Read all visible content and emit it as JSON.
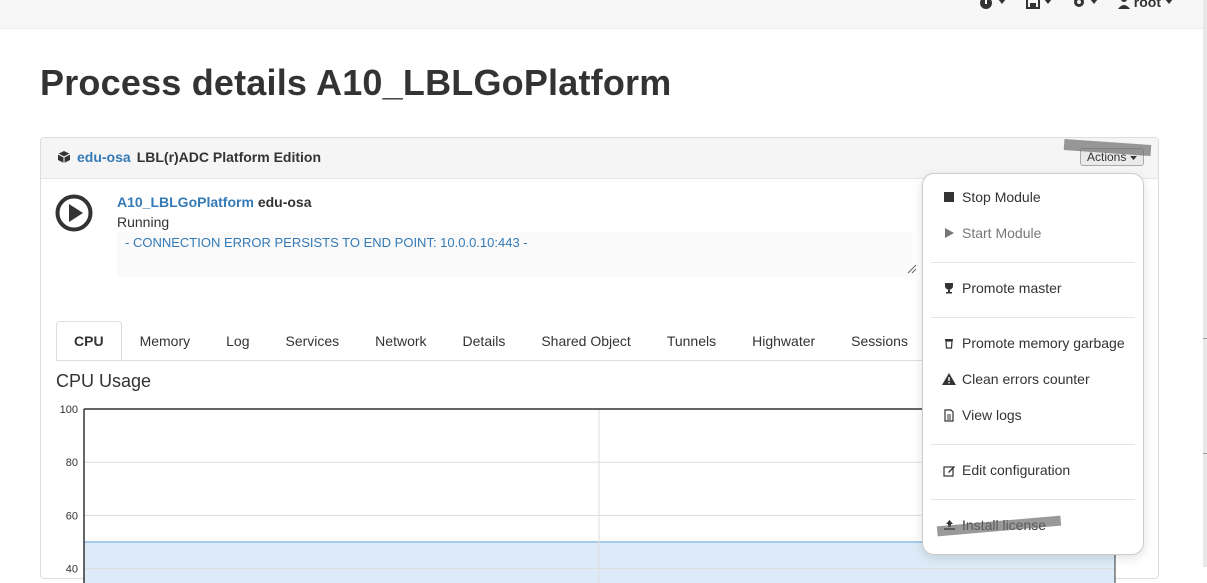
{
  "topnav": {
    "items": [
      {
        "icon": "dashboard-icon"
      },
      {
        "icon": "save-icon"
      },
      {
        "icon": "gear-icon"
      },
      {
        "icon": "user-icon",
        "label": "root"
      }
    ]
  },
  "page": {
    "title": "Process details A10_LBLGoPlatform"
  },
  "panel": {
    "site": "edu-osa",
    "edition": "LBL(r)ADC Platform Edition",
    "actions_label": "Actions"
  },
  "process": {
    "name": "A10_LBLGoPlatform",
    "site": "edu-osa",
    "status": "Running",
    "log": "- CONNECTION ERROR PERSISTS TO END POINT: 10.0.0.10:443 -"
  },
  "tabs": [
    "CPU",
    "Memory",
    "Log",
    "Services",
    "Network",
    "Details",
    "Shared Object",
    "Tunnels",
    "Highwater",
    "Sessions"
  ],
  "active_tab": "CPU",
  "chart_data": {
    "type": "area",
    "title": "CPU Usage",
    "ylim": [
      0,
      100
    ],
    "yticks": [
      "100",
      "80",
      "60",
      "40"
    ],
    "grid": true,
    "series": [
      {
        "values": [
          50,
          50
        ]
      }
    ]
  },
  "actions_menu": {
    "items": [
      {
        "label": "Stop Module",
        "icon": "stop-icon"
      },
      {
        "label": "Start Module",
        "icon": "play-icon",
        "disabled": true
      },
      {
        "label": "Promote master",
        "icon": "trophy-icon"
      },
      {
        "label": "Promote memory garbage",
        "icon": "trash-icon"
      },
      {
        "label": "Clean errors counter",
        "icon": "warning-icon"
      },
      {
        "label": "View logs",
        "icon": "file-icon"
      },
      {
        "label": "Edit configuration",
        "icon": "edit-icon"
      },
      {
        "label": "Install license",
        "icon": "upload-icon"
      }
    ]
  },
  "colors": {
    "link": "#337ab7",
    "chart_fill": "#dcebf7",
    "chart_line": "#a7cbe8"
  }
}
